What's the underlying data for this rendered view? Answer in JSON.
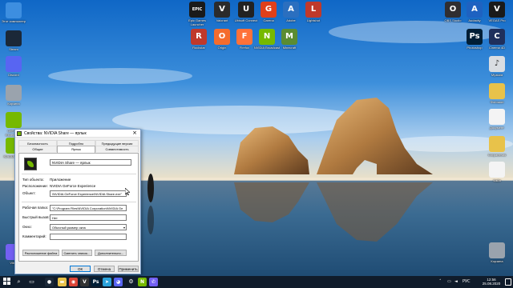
{
  "desktop": {
    "icons_left": [
      {
        "label": "Этот компьютер",
        "icon": "computer-icon",
        "color": "#3d8ee0"
      },
      {
        "label": "Steam",
        "icon": "steam-icon",
        "color": "#1b2838"
      },
      {
        "label": "Discord",
        "icon": "discord-icon",
        "color": "#5865f2"
      },
      {
        "label": "Корзина",
        "icon": "recycle-bin-icon",
        "color": "#9aa3ad"
      },
      {
        "label": "GeForce Experience",
        "icon": "nvidia-icon",
        "color": "#76b900"
      },
      {
        "label": "NVIDIA Share",
        "icon": "nvidia-share-icon",
        "color": "#76b900"
      },
      {
        "label": "Viber",
        "icon": "viber-icon",
        "color": "#7360f2"
      }
    ],
    "icons_top": [
      {
        "label": "Epic Games Launcher",
        "icon": "epic-games-icon",
        "color": "#1a1a1a",
        "glyph": "EPIC"
      },
      {
        "label": "Valorant",
        "icon": "valorant-icon",
        "color": "#2b2b2b",
        "glyph": "V"
      },
      {
        "label": "Ubisoft Connect",
        "icon": "ubisoft-icon",
        "color": "#222222",
        "glyph": "U"
      },
      {
        "label": "Garena",
        "icon": "garena-icon",
        "color": "#e0401a",
        "glyph": "G"
      },
      {
        "label": "Adobe",
        "icon": "adobe-icon",
        "color": "#2b6fbf",
        "glyph": "A"
      },
      {
        "label": "Lightshot",
        "icon": "lightshot-icon",
        "color": "#c0392b",
        "glyph": "L"
      },
      {
        "label": "Rockstar",
        "icon": "rockstar-icon",
        "color": "#c0392b",
        "glyph": "R"
      },
      {
        "label": "Origin",
        "icon": "origin-icon",
        "color": "#f56c2d",
        "glyph": "O"
      },
      {
        "label": "Firefox",
        "icon": "firefox-icon",
        "color": "#ff7139",
        "glyph": "F"
      },
      {
        "label": "NVIDIA Broadcast",
        "icon": "nvidia-broadcast-icon",
        "color": "#76b900",
        "glyph": "N"
      },
      {
        "label": "Minecraft",
        "icon": "minecraft-icon",
        "color": "#5b8c32",
        "glyph": "M"
      }
    ],
    "icons_right": [
      {
        "label": "OBS Studio",
        "icon": "obs-icon",
        "color": "#302e31",
        "glyph": "O"
      },
      {
        "label": "Audacity",
        "icon": "audacity-icon",
        "color": "#1e62c1",
        "glyph": "A"
      },
      {
        "label": "VEGAS Pro",
        "icon": "vegas-icon",
        "color": "#1a1a1a",
        "glyph": "V"
      },
      {
        "label": "Photoshop",
        "icon": "photoshop-icon",
        "color": "#001e36",
        "glyph": "Ps"
      },
      {
        "label": "Cinema 4D",
        "icon": "cinema4d-icon",
        "color": "#1f2f5c",
        "glyph": "C"
      },
      {
        "label": "Музыка",
        "icon": "music-folder-icon",
        "color": "#d9dde2",
        "glyph": "♪"
      },
      {
        "label": "Фотошоп",
        "icon": "folder-icon",
        "color": "#e8c24a",
        "glyph": ""
      },
      {
        "label": "Документ",
        "icon": "document-icon",
        "color": "#f4f4f4",
        "glyph": ""
      },
      {
        "label": "Сохранения",
        "icon": "folder-icon",
        "color": "#e8c24a",
        "glyph": ""
      },
      {
        "label": "Файл",
        "icon": "file-icon",
        "color": "#f4f4f4",
        "glyph": ""
      },
      {
        "label": "Корзина",
        "icon": "recycle-bin-icon",
        "color": "#9aa3ad",
        "glyph": ""
      }
    ]
  },
  "dialog": {
    "title": "Свойства: NVIDIA Share — ярлык",
    "tabs_top": [
      "Безопасность",
      "Подробно",
      "Предыдущие версии"
    ],
    "tabs_bottom": [
      "Общие",
      "Ярлык",
      "Совместимость"
    ],
    "active_tab": "Ярлык",
    "shortcut_name": "NVIDIA Share — ярлык",
    "rows": {
      "type_label": "Тип объекта:",
      "type_value": "Приложение",
      "location_label": "Расположение:",
      "location_value": "NVIDIA GeForce Experience",
      "target_label": "Объект:",
      "target_value": "\\NVIDIA GeForce Experience\\NVIDIA Share.exe\"",
      "startin_label": "Рабочая папка:",
      "startin_value": "\"C:\\Program Files\\NVIDIA Corporation\\NVIDIA Ge",
      "shortcutkey_label": "Быстрый вызов:",
      "shortcutkey_value": "Нет",
      "run_label": "Окно:",
      "run_value": "Обычный размер окна",
      "comment_label": "Комментарий:",
      "comment_value": ""
    },
    "panel_buttons": [
      "Расположение файла",
      "Сменить значок...",
      "Дополнительно..."
    ],
    "buttons": {
      "ok": "ОК",
      "cancel": "Отмена",
      "apply": "Применить"
    }
  },
  "taskbar": {
    "start_icon": "windows-start-icon",
    "items": [
      {
        "icon": "search-icon",
        "glyph": "⌕",
        "color": ""
      },
      {
        "icon": "task-view-icon",
        "glyph": "▭",
        "color": ""
      },
      {
        "icon": "steam-icon",
        "glyph": "●",
        "color": "#1b2838"
      },
      {
        "icon": "file-explorer-icon",
        "glyph": "▬",
        "color": "#e8c24a"
      },
      {
        "icon": "chrome-icon",
        "glyph": "◉",
        "color": "#db4437"
      },
      {
        "icon": "vegas-icon",
        "glyph": "V",
        "color": "#333333"
      },
      {
        "icon": "photoshop-icon",
        "glyph": "Ps",
        "color": "#001e36"
      },
      {
        "icon": "telegram-icon",
        "glyph": "➤",
        "color": "#2aa1da"
      },
      {
        "icon": "discord-icon",
        "glyph": "◕",
        "color": "#5865f2"
      },
      {
        "icon": "settings-icon",
        "glyph": "⚙",
        "color": ""
      },
      {
        "icon": "nvidia-icon",
        "glyph": "N",
        "color": "#76b900"
      },
      {
        "icon": "viber-icon",
        "glyph": "✆",
        "color": "#7360f2"
      }
    ],
    "tray": {
      "chevron": "˄",
      "lang": "РУС"
    },
    "time": "12:56",
    "date": "25.08.2020"
  }
}
